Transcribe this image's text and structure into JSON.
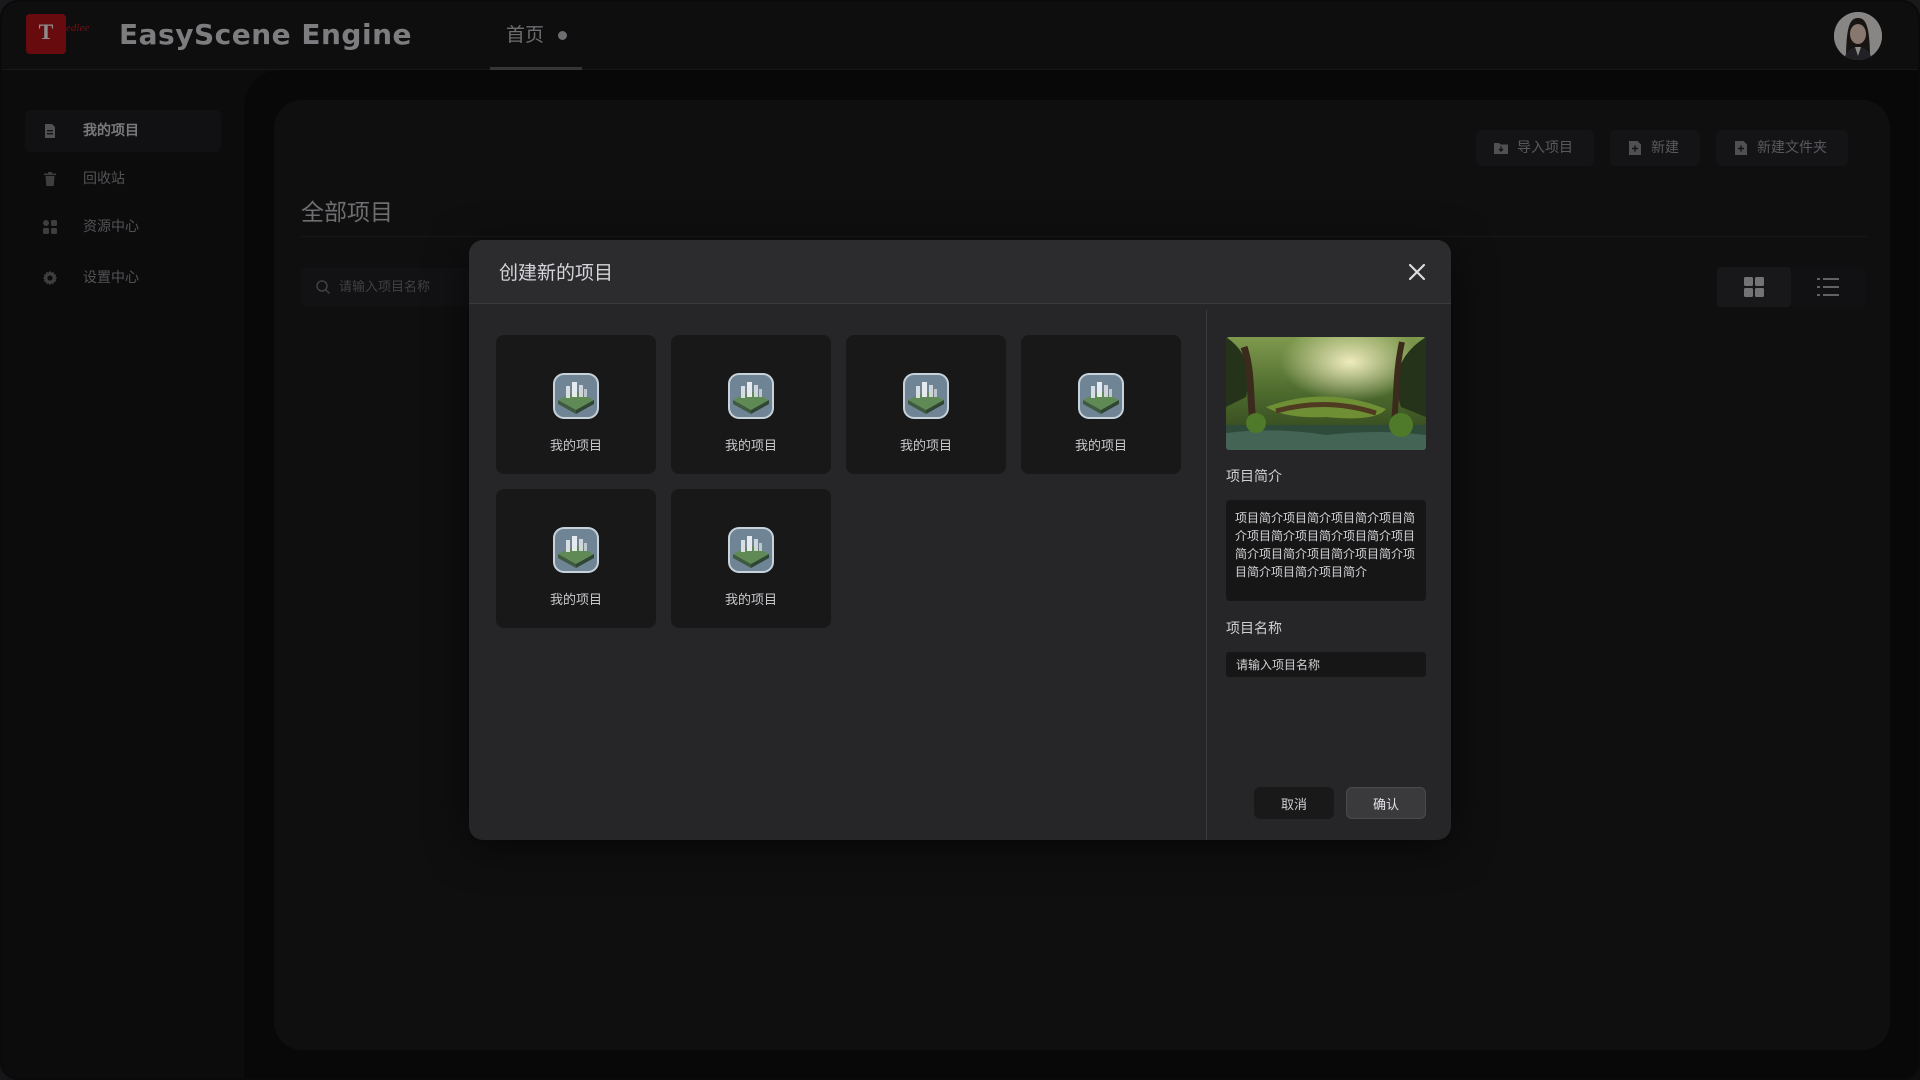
{
  "app": {
    "logo_letter": "T",
    "logo_text": "ediee",
    "title": "EasyScene Engine",
    "brand_color": "#c0161e"
  },
  "nav": {
    "home_tab": "首页"
  },
  "sidebar": {
    "items": [
      {
        "label": "我的项目",
        "icon": "document-icon",
        "active": true
      },
      {
        "label": "回收站",
        "icon": "trash-icon",
        "active": false
      },
      {
        "label": "资源中心",
        "icon": "apps-icon",
        "active": false
      },
      {
        "label": "设置中心",
        "icon": "gear-icon",
        "active": false
      }
    ]
  },
  "toolbar": {
    "import_label": "导入项目",
    "new_label": "新建",
    "new_folder_label": "新建文件夹"
  },
  "main": {
    "section_title": "全部项目",
    "search_placeholder": "请输入项目名称"
  },
  "modal": {
    "title": "创建新的项目",
    "templates": [
      {
        "label": "我的项目"
      },
      {
        "label": "我的项目"
      },
      {
        "label": "我的项目"
      },
      {
        "label": "我的项目"
      },
      {
        "label": "我的项目"
      },
      {
        "label": "我的项目"
      }
    ],
    "description_label": "项目简介",
    "description_text": "项目简介项目简介项目简介项目简介项目简介项目简介项目简介项目简介项目简介项目简介项目简介项目简介项目简介项目简介",
    "name_label": "项目名称",
    "name_placeholder": "请输入项目名称",
    "cancel_label": "取消",
    "confirm_label": "确认"
  }
}
